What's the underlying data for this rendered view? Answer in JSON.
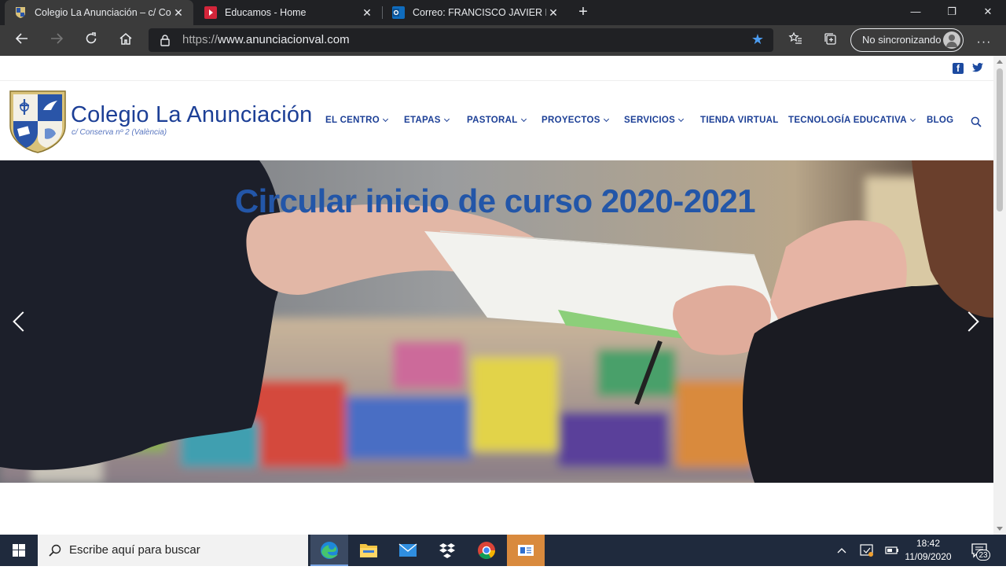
{
  "browser": {
    "tabs": [
      {
        "title": "Colegio La Anunciación – c/ Con",
        "active": true,
        "favicon": "school-shield-icon"
      },
      {
        "title": "Educamos - Home",
        "active": false,
        "favicon": "educamos-icon"
      },
      {
        "title": "Correo: FRANCISCO JAVIER NAV",
        "active": false,
        "favicon": "outlook-icon"
      }
    ],
    "new_tab": "+",
    "window_controls": {
      "minimize": "—",
      "restore": "❐",
      "close": "✕"
    },
    "url_protocol": "https://",
    "url_host": "www.anunciacionval.com",
    "profile_label": "No sincronizando",
    "accent": "#4c9cf0"
  },
  "site": {
    "title": "Colegio La Anunciación",
    "subtitle": "c/ Conserva nº 2 (València)",
    "brand_color": "#1c3f96",
    "nav": [
      {
        "label": "EL CENTRO",
        "dropdown": true
      },
      {
        "label": "ETAPAS",
        "dropdown": true
      },
      {
        "label": "PASTORAL",
        "dropdown": true
      },
      {
        "label": "PROYECTOS",
        "dropdown": true
      },
      {
        "label": "SERVICIOS",
        "dropdown": true
      },
      {
        "label": "TIENDA VIRTUAL",
        "dropdown": false
      },
      {
        "label": "TECNOLOGÍA EDUCATIVA",
        "dropdown": true
      },
      {
        "label": "BLOG",
        "dropdown": false
      }
    ],
    "social": {
      "facebook": "f",
      "twitter": "t"
    }
  },
  "hero": {
    "title": "Circular inicio de curso 2020-2021"
  },
  "taskbar": {
    "search_placeholder": "Escribe aquí para buscar",
    "time": "18:42",
    "date": "11/09/2020",
    "notification_count": "23",
    "apps": [
      "edge-icon",
      "file-explorer-icon",
      "mail-icon",
      "dropbox-icon",
      "chrome-icon",
      "whiteboard-icon"
    ]
  }
}
